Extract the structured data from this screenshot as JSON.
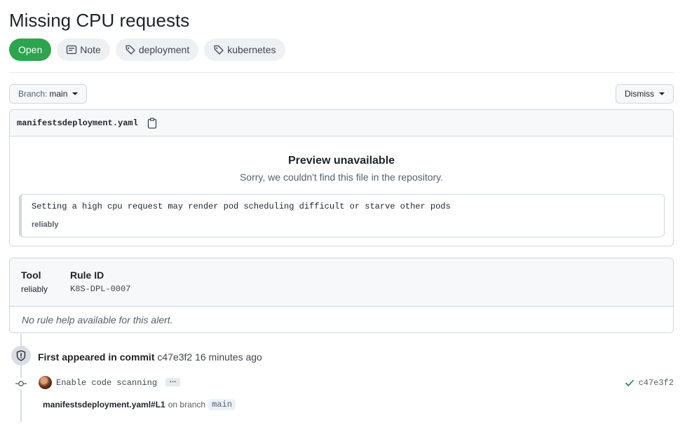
{
  "alert": {
    "title": "Missing CPU requests",
    "status": "Open",
    "severity": "Note",
    "tags": [
      "deployment",
      "kubernetes"
    ]
  },
  "toolbar": {
    "branch_prefix": "Branch:",
    "branch_value": "main",
    "dismiss_label": "Dismiss"
  },
  "file": {
    "name": "manifestsdeployment.yaml",
    "preview_title": "Preview unavailable",
    "preview_subtitle": "Sorry, we couldn't find this file in the repository.",
    "message": "Setting a high cpu request may render pod scheduling difficult or starve other pods",
    "message_tool": "reliably"
  },
  "rule": {
    "tool_header": "Tool",
    "tool_value": "reliably",
    "rule_id_header": "Rule ID",
    "rule_id_value": "K8S-DPL-0007",
    "help_text": "No rule help available for this alert."
  },
  "timeline": {
    "first_appeared_bold": "First appeared in commit",
    "first_appeared_rest": "c47e3f2 16 minutes ago",
    "commit_message": "Enable code scanning",
    "commit_ellipsis": "…",
    "commit_sha": "c47e3f2",
    "location_path": "manifestsdeployment.yaml#L1",
    "location_on": "on branch",
    "location_branch": "main"
  },
  "colors": {
    "open_green": "#2da44e",
    "check_green": "#1a7f37"
  },
  "icons": [
    "note-icon",
    "tag-icon",
    "copy-icon",
    "shield-icon",
    "commit-icon",
    "check-icon"
  ]
}
